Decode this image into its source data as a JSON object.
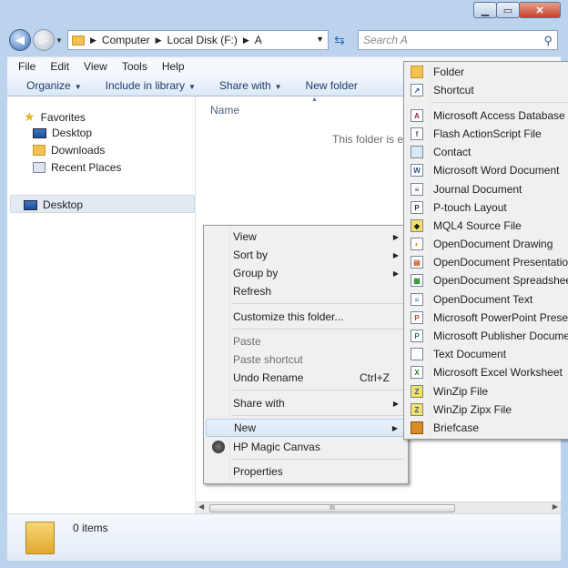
{
  "window": {
    "caption": {
      "minimize": "▁",
      "maximize": "▭",
      "close": "✕"
    }
  },
  "address": {
    "crumbs": [
      "Computer",
      "Local Disk (F:)",
      "A"
    ],
    "search_placeholder": "Search A"
  },
  "menubar": [
    "File",
    "Edit",
    "View",
    "Tools",
    "Help"
  ],
  "commands": [
    {
      "label": "Organize",
      "dropdown": true
    },
    {
      "label": "Include in library",
      "dropdown": true
    },
    {
      "label": "Share with",
      "dropdown": true
    },
    {
      "label": "New folder",
      "dropdown": false
    }
  ],
  "navpane": {
    "favorites": "Favorites",
    "items": [
      "Desktop",
      "Downloads",
      "Recent Places"
    ],
    "desktop_root": "Desktop"
  },
  "content": {
    "column_name": "Name",
    "empty_message": "This folder is em",
    "scroll_grip": "III"
  },
  "details": {
    "items_count": "0 items"
  },
  "context_menu": {
    "view": "View",
    "sort_by": "Sort by",
    "group_by": "Group by",
    "refresh": "Refresh",
    "customize": "Customize this folder...",
    "paste": "Paste",
    "paste_shortcut": "Paste shortcut",
    "undo_rename": "Undo Rename",
    "undo_shortcut": "Ctrl+Z",
    "share_with": "Share with",
    "new": "New",
    "hp_magic_canvas": "HP Magic Canvas",
    "properties": "Properties"
  },
  "new_submenu": {
    "folder": "Folder",
    "shortcut": "Shortcut",
    "access": "Microsoft Access Database",
    "flash": "Flash ActionScript File",
    "contact": "Contact",
    "word": "Microsoft Word Document",
    "journal": "Journal Document",
    "ptouch": "P-touch Layout",
    "mql4": "MQL4 Source File",
    "od_drawing": "OpenDocument Drawing",
    "od_presentation": "OpenDocument Presentation",
    "od_spreadsheet": "OpenDocument Spreadsheet",
    "od_text": "OpenDocument Text",
    "powerpoint": "Microsoft PowerPoint Presenta",
    "publisher": "Microsoft Publisher Document",
    "text": "Text Document",
    "excel": "Microsoft Excel Worksheet",
    "winzip": "WinZip File",
    "winzipx": "WinZip Zipx File",
    "briefcase": "Briefcase"
  }
}
